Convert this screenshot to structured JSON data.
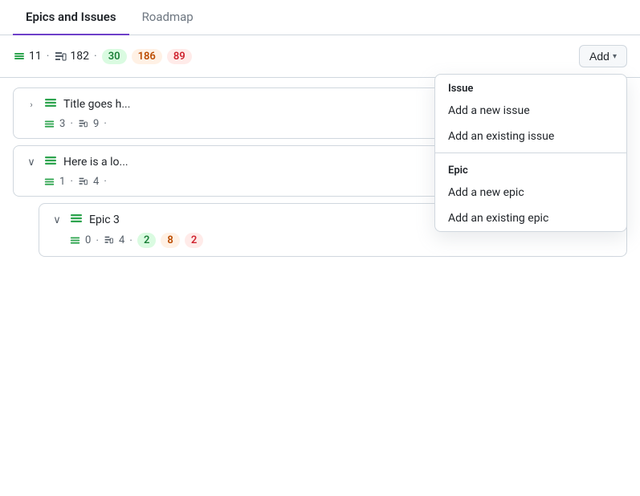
{
  "tabs": [
    {
      "id": "epics",
      "label": "Epics and Issues",
      "active": true
    },
    {
      "id": "roadmap",
      "label": "Roadmap",
      "active": false
    }
  ],
  "toolbar": {
    "epics_count": "11",
    "issues_count": "182",
    "badge_green": "30",
    "badge_orange": "186",
    "badge_red": "89",
    "add_button_label": "Add",
    "add_chevron": "▾"
  },
  "epics": [
    {
      "id": "epic1",
      "expand_icon": "›",
      "expanded": false,
      "title": "Title goes h...",
      "meta_epics": "3",
      "meta_issues": "9",
      "meta_suffix": "·"
    },
    {
      "id": "epic2",
      "expand_icon": "∨",
      "expanded": true,
      "title": "Here is a lo...",
      "meta_epics": "1",
      "meta_issues": "4",
      "meta_suffix": "·"
    },
    {
      "id": "epic3",
      "expand_icon": "∨",
      "expanded": true,
      "title": "Epic 3",
      "meta_epics": "0",
      "meta_issues": "4",
      "badge_green": "2",
      "badge_orange": "8",
      "badge_red": "2",
      "meta_suffix": "·"
    }
  ],
  "dropdown": {
    "visible": true,
    "sections": [
      {
        "header": "Issue",
        "items": [
          "Add a new issue",
          "Add an existing issue"
        ]
      },
      {
        "header": "Epic",
        "items": [
          "Add a new epic",
          "Add an existing epic"
        ]
      }
    ]
  },
  "icons": {
    "epic_icon": "⊟",
    "issue_icon": "⧉"
  }
}
